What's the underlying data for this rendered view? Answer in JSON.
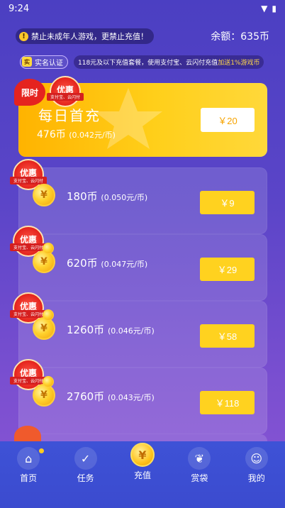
{
  "status": {
    "time": "9:24"
  },
  "header": {
    "warning": "禁止未成年人游戏，更禁止充值！",
    "balance_label": "余额：635币"
  },
  "info": {
    "verify_label": "实名认证",
    "verify_icon_text": "实",
    "promo_main": "118元及以下充值套餐，使用支付宝、云闪付充值",
    "promo_highlight": "加送1%游戏币"
  },
  "featured": {
    "limit_tag": "限时",
    "badge": "优惠",
    "badge_ribbon": "支付宝、云闪付",
    "title": "每日首充",
    "coins": "476币",
    "rate": "(0.042元/币)",
    "price": "￥20"
  },
  "packages": [
    {
      "badge": "优惠",
      "ribbon": "支付宝、云闪付",
      "coins": "180币",
      "rate": "(0.050元/币)",
      "price": "￥9"
    },
    {
      "badge": "优惠",
      "ribbon": "支付宝、云闪付",
      "coins": "620币",
      "rate": "(0.047元/币)",
      "price": "￥29"
    },
    {
      "badge": "优惠",
      "ribbon": "支付宝、云闪付",
      "coins": "1260币",
      "rate": "(0.046元/币)",
      "price": "￥58"
    },
    {
      "badge": "优惠",
      "ribbon": "支付宝、云闪付",
      "coins": "2760币",
      "rate": "(0.043元/币)",
      "price": "￥118"
    }
  ],
  "nav": [
    {
      "label": "首页",
      "icon": "home-icon"
    },
    {
      "label": "任务",
      "icon": "task-icon"
    },
    {
      "label": "充值",
      "icon": "coin-icon"
    },
    {
      "label": "赏袋",
      "icon": "lucky-bag-icon"
    },
    {
      "label": "我的",
      "icon": "profile-icon"
    }
  ]
}
